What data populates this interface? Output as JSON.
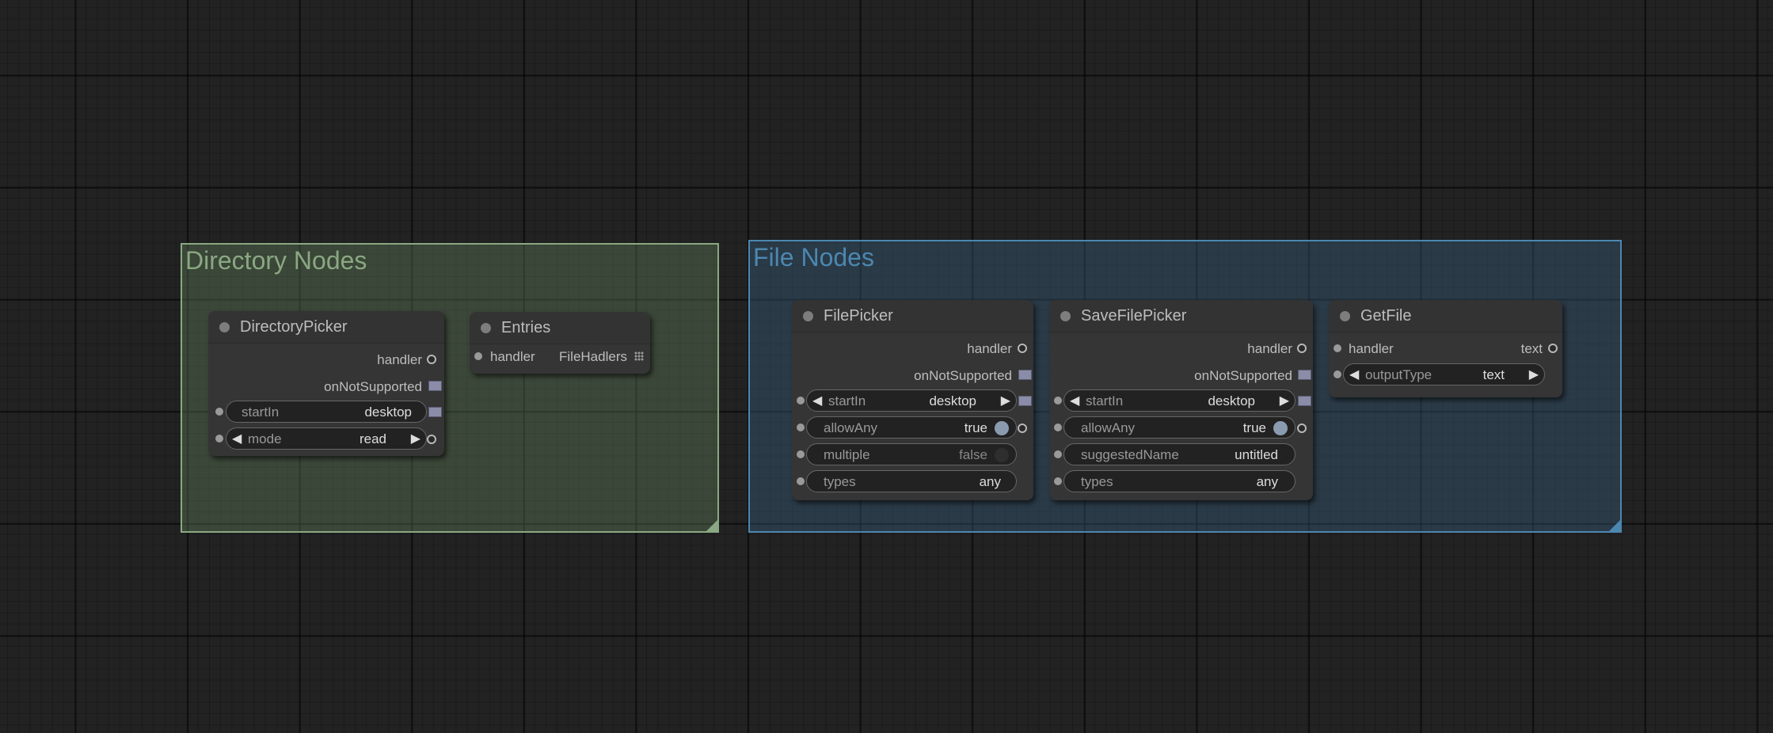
{
  "groups": {
    "directory": {
      "title": "Directory Nodes",
      "color": "#8aa883"
    },
    "file": {
      "title": "File Nodes",
      "color": "#4c87b0"
    }
  },
  "nodes": {
    "directory_picker": {
      "title": "DirectoryPicker",
      "outputs": [
        "handler",
        "onNotSupported"
      ],
      "widgets": {
        "start_in": {
          "name": "startIn",
          "value": "desktop"
        },
        "mode": {
          "name": "mode",
          "value": "read"
        }
      }
    },
    "entries": {
      "title": "Entries",
      "input": "handler",
      "output": "FileHadlers"
    },
    "file_picker": {
      "title": "FilePicker",
      "outputs": [
        "handler",
        "onNotSupported"
      ],
      "widgets": {
        "start_in": {
          "name": "startIn",
          "value": "desktop"
        },
        "allow_any": {
          "name": "allowAny",
          "value": "true"
        },
        "multiple": {
          "name": "multiple",
          "value": "false"
        },
        "types": {
          "name": "types",
          "value": "any"
        }
      }
    },
    "save_file_picker": {
      "title": "SaveFilePicker",
      "outputs": [
        "handler",
        "onNotSupported"
      ],
      "widgets": {
        "start_in": {
          "name": "startIn",
          "value": "desktop"
        },
        "allow_any": {
          "name": "allowAny",
          "value": "true"
        },
        "suggested_name": {
          "name": "suggestedName",
          "value": "untitled"
        },
        "types": {
          "name": "types",
          "value": "any"
        }
      }
    },
    "get_file": {
      "title": "GetFile",
      "input": "handler",
      "output": "text",
      "widgets": {
        "output_type": {
          "name": "outputType",
          "value": "text"
        }
      }
    }
  },
  "colors": {
    "canvas_background": "#222222",
    "node_background": "#353535",
    "toggle_on": "#8a9bb0",
    "event_slot": "#8a8ca8"
  }
}
